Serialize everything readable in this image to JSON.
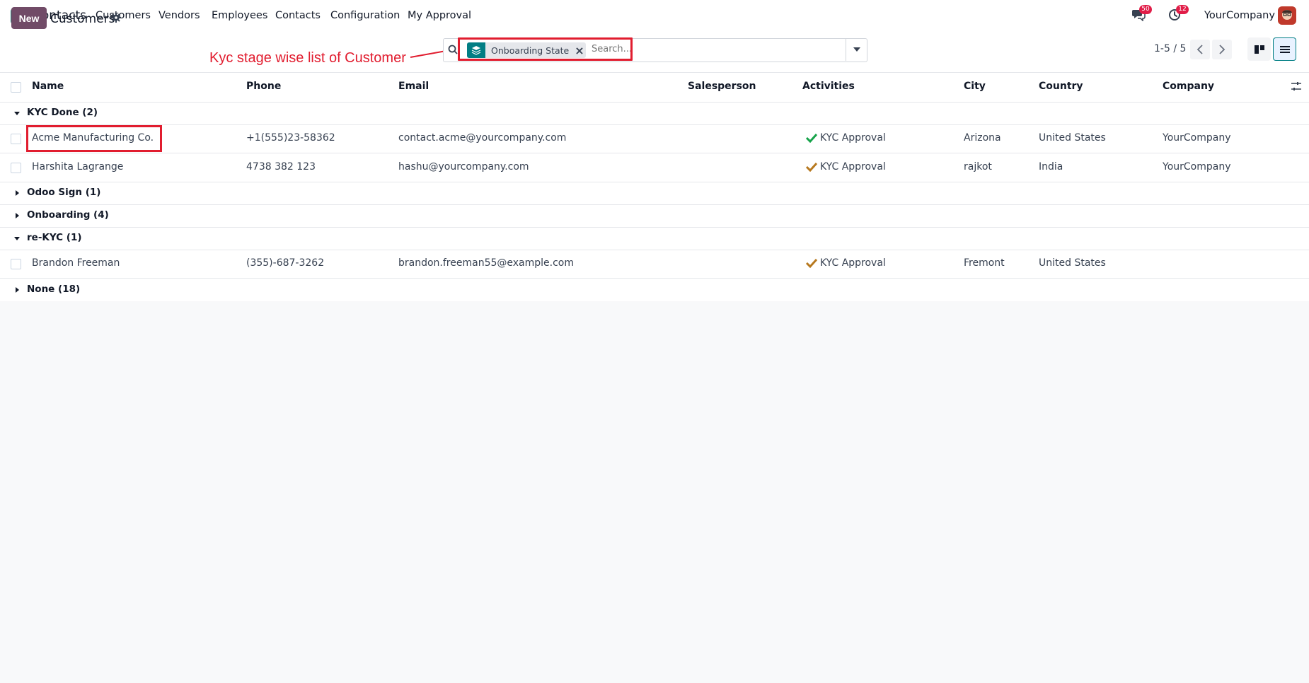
{
  "navbar": {
    "app_name": "Contacts",
    "menu": [
      "Customers",
      "Vendors",
      "Employees",
      "Contacts",
      "Configuration",
      "My Approval"
    ],
    "messages_badge": "50",
    "activities_badge": "12",
    "company": "YourCompany"
  },
  "control": {
    "new_label": "New",
    "breadcrumb": "Customers",
    "annotation": "Kyc stage wise list of Customer",
    "facet_label": "Onboarding State",
    "search_placeholder": "Search...",
    "pager": "1-5 / 5"
  },
  "table": {
    "headers": [
      "Name",
      "Phone",
      "Email",
      "Salesperson",
      "Activities",
      "City",
      "Country",
      "Company"
    ],
    "groups": [
      {
        "label": "KYC Done (2)",
        "expanded": true
      },
      {
        "label": "Odoo Sign (1)",
        "expanded": false
      },
      {
        "label": "Onboarding (4)",
        "expanded": false
      },
      {
        "label": "re-KYC (1)",
        "expanded": true
      },
      {
        "label": "None (18)",
        "expanded": false
      }
    ],
    "rows": [
      {
        "name": "Acme Manufacturing Co.",
        "phone": "+1(555)23-58362",
        "email": "contact.acme@yourcompany.com",
        "salesperson": "",
        "activity": "KYC Approval",
        "city": "Arizona",
        "country": "United States",
        "company": "YourCompany"
      },
      {
        "name": "Harshita Lagrange",
        "phone": "4738 382 123",
        "email": "hashu@yourcompany.com",
        "salesperson": "",
        "activity": "KYC Approval",
        "city": "rajkot",
        "country": "India",
        "company": "YourCompany"
      },
      {
        "name": "Brandon Freeman",
        "phone": "(355)-687-3262",
        "email": "brandon.freeman55@example.com",
        "salesperson": "",
        "activity": "KYC Approval",
        "city": "Fremont",
        "country": "United States",
        "company": ""
      }
    ]
  },
  "colors": {
    "primary": "#714b67",
    "accent": "#017e84",
    "annotation": "#e11d2f",
    "activity_done": "#16a34a",
    "activity_warning": "#b7791f"
  }
}
